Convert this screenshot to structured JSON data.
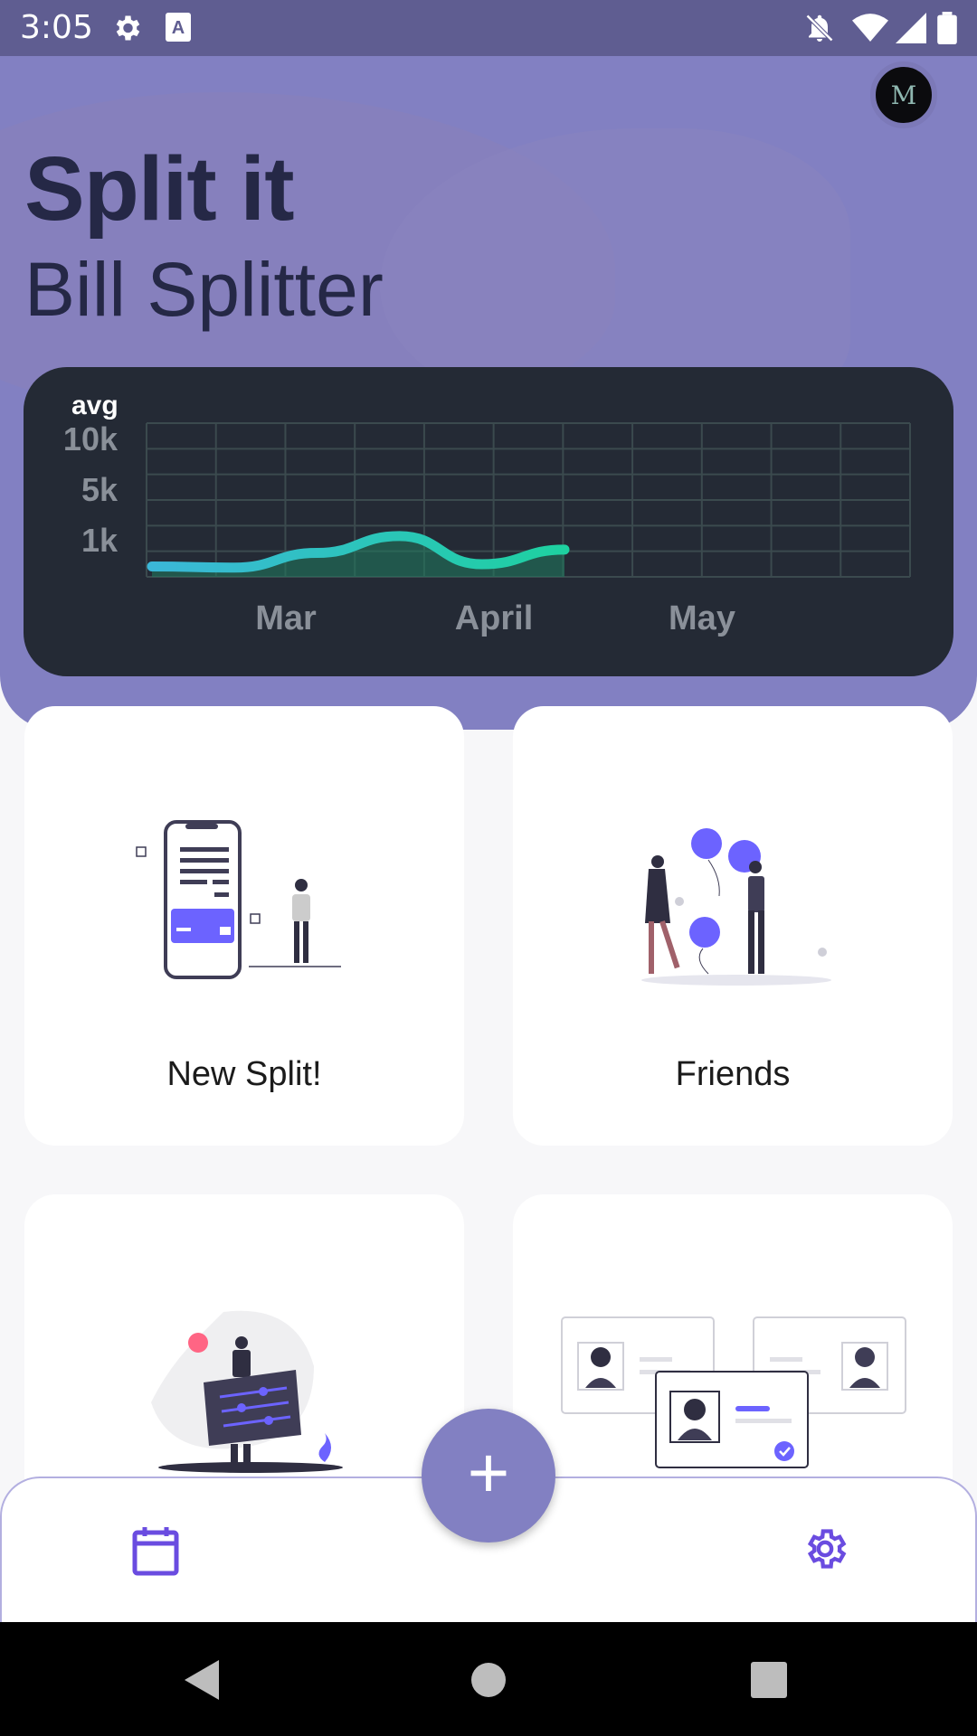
{
  "status_bar": {
    "time": "3:05",
    "icons": [
      "settings-icon",
      "keyboard-a-icon",
      "notifications-off-icon",
      "wifi-icon",
      "signal-icon",
      "battery-icon"
    ]
  },
  "header": {
    "title": "Split it",
    "subtitle": "Bill Splitter",
    "avatar_initial": "M"
  },
  "chart_data": {
    "type": "area",
    "title": "avg",
    "y_tick_labels": [
      "10k",
      "5k",
      "1k"
    ],
    "x_tick_labels": [
      "Mar",
      "April",
      "May"
    ],
    "grid": true,
    "series": [
      {
        "values": [
          800,
          700,
          2000,
          3500,
          1000,
          2300
        ]
      }
    ],
    "colors": {
      "line_start": "#3bb7d8",
      "line_end": "#1ed1a0",
      "fill": "#1f7c5f",
      "grid": "#3b4a4e",
      "background": "#242a35"
    }
  },
  "tiles": [
    {
      "label": "New Split!",
      "art": "phone-payment-illustration"
    },
    {
      "label": "Friends",
      "art": "friends-balloons-illustration"
    },
    {
      "label": "",
      "art": "settings-board-illustration"
    },
    {
      "label": "",
      "art": "profile-cards-illustration"
    }
  ],
  "fab": {
    "label": "+"
  },
  "bottom_nav": {
    "left_icon": "calendar-icon",
    "right_icon": "gear-icon"
  },
  "system_nav": {
    "icons": [
      "back-icon",
      "home-icon",
      "recents-icon"
    ]
  },
  "colors": {
    "accent": "#8280c2",
    "icon_purple": "#6a4ce0",
    "dark_text": "#252846"
  }
}
